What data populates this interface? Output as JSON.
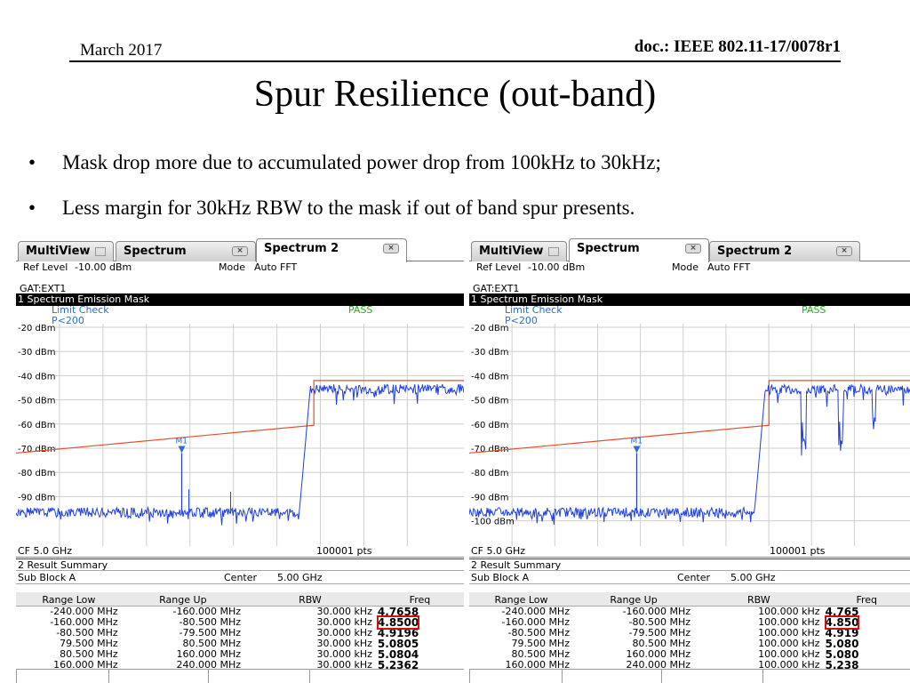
{
  "header": {
    "date": "March 2017",
    "doc": "doc.: IEEE 802.11-17/0078r1"
  },
  "title": "Spur Resilience (out-band)",
  "bullets": [
    "Mask drop more due to accumulated power drop from 100kHz to 30kHz;",
    "Less margin for 30kHz RBW to the mask if out of band spur presents."
  ],
  "shots": [
    {
      "tabs": [
        "MultiView",
        "Spectrum",
        "Spectrum 2"
      ],
      "active_tab": 2,
      "ref_label": "Ref Level",
      "ref_value": "-10.00 dBm",
      "mode_label": "Mode",
      "mode_value": "Auto FFT",
      "trigger": "GAT:EXT1",
      "window_title": "1 Spectrum Emission Mask",
      "limit_check": "Limit Check",
      "limit_value": "P<200",
      "pass": "PASS",
      "marker": "M1",
      "y_ticks": [
        "-20 dBm",
        "-30 dBm",
        "-40 dBm",
        "-50 dBm",
        "-60 dBm",
        "-70 dBm",
        "-80 dBm",
        "-90 dBm"
      ],
      "cf": "CF 5.0 GHz",
      "pts": "100001 pts",
      "result_title": "2 Result Summary",
      "sub_block": "Sub Block A",
      "center_label": "Center",
      "center_value": "5.00 GHz",
      "columns": [
        "Range Low",
        "Range Up",
        "RBW",
        "Freq"
      ],
      "rows": [
        [
          "-240.000 MHz",
          "-160.000 MHz",
          "30.000 kHz",
          "4.7658"
        ],
        [
          "-160.000 MHz",
          "-80.500 MHz",
          "30.000 kHz",
          "4.8500"
        ],
        [
          "-80.500 MHz",
          "-79.500 MHz",
          "30.000 kHz",
          "4.9196"
        ],
        [
          "79.500 MHz",
          "80.500 MHz",
          "30.000 kHz",
          "5.0805"
        ],
        [
          "80.500 MHz",
          "160.000 MHz",
          "30.000 kHz",
          "5.0804"
        ],
        [
          "160.000 MHz",
          "240.000 MHz",
          "30.000 kHz",
          "5.2362"
        ]
      ],
      "highlight_row": 1
    },
    {
      "tabs": [
        "MultiView",
        "Spectrum",
        "Spectrum 2"
      ],
      "active_tab": 1,
      "ref_label": "Ref Level",
      "ref_value": "-10.00 dBm",
      "mode_label": "Mode",
      "mode_value": "Auto FFT",
      "trigger": "GAT:EXT1",
      "window_title": "1 Spectrum Emission Mask",
      "limit_check": "Limit Check",
      "limit_value": "P<200",
      "pass": "PASS",
      "marker": "M1",
      "y_ticks": [
        "-20 dBm",
        "-30 dBm",
        "-40 dBm",
        "-50 dBm",
        "-60 dBm",
        "-70 dBm",
        "-80 dBm",
        "-90 dBm",
        "-100 dBm"
      ],
      "cf": "CF 5.0 GHz",
      "pts": "100001 pts",
      "result_title": "2 Result Summary",
      "sub_block": "Sub Block A",
      "center_label": "Center",
      "center_value": "5.00 GHz",
      "columns": [
        "Range Low",
        "Range Up",
        "RBW",
        "Freq"
      ],
      "rows": [
        [
          "-240.000 MHz",
          "-160.000 MHz",
          "100.000 kHz",
          "4.765"
        ],
        [
          "-160.000 MHz",
          "-80.500 MHz",
          "100.000 kHz",
          "4.850"
        ],
        [
          "-80.500 MHz",
          "-79.500 MHz",
          "100.000 kHz",
          "4.919"
        ],
        [
          "79.500 MHz",
          "80.500 MHz",
          "100.000 kHz",
          "5.080"
        ],
        [
          "80.500 MHz",
          "160.000 MHz",
          "100.000 kHz",
          "5.080"
        ],
        [
          "160.000 MHz",
          "240.000 MHz",
          "100.000 kHz",
          "5.238"
        ]
      ],
      "highlight_row": 1
    }
  ],
  "colors": {
    "trace": "#1f3fe0",
    "limit": "#e05030",
    "label_blue": "#2a6fd0",
    "pass_green": "#20b020",
    "highlight": "#d01010"
  }
}
